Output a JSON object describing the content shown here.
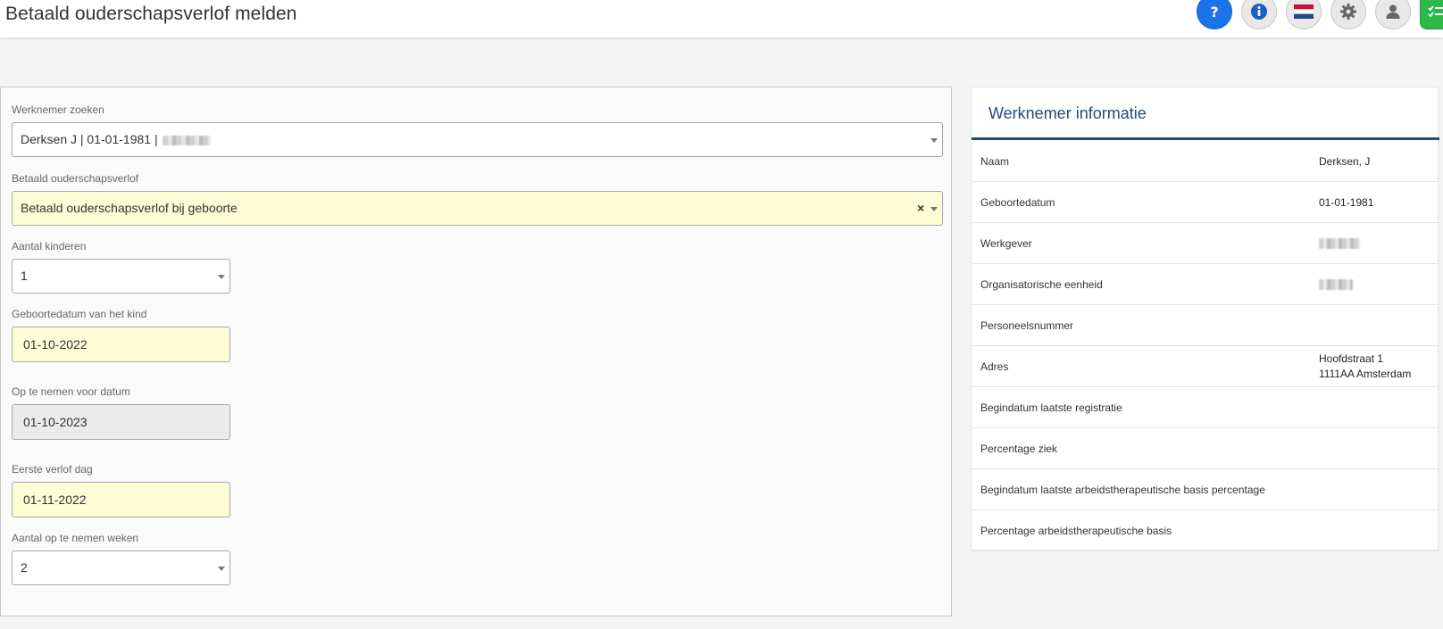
{
  "page": {
    "title": "Betaald ouderschapsverlof melden"
  },
  "header_icons": [
    {
      "name": "help-icon",
      "color": "#1a73e8"
    },
    {
      "name": "info-icon"
    },
    {
      "name": "dutch-flag-icon"
    },
    {
      "name": "gear-icon"
    },
    {
      "name": "user-icon"
    },
    {
      "name": "checklist-icon",
      "color": "#2db84a"
    }
  ],
  "form": {
    "werknemer_zoeken": {
      "label": "Werknemer zoeken",
      "value": "Derksen J | 01-01-1981 |"
    },
    "verlof_type": {
      "label": "Betaald ouderschapsverlof",
      "value": "Betaald ouderschapsverlof bij geboorte",
      "clear": "×"
    },
    "aantal_kinderen": {
      "label": "Aantal kinderen",
      "value": "1"
    },
    "geboortedatum_kind": {
      "label": "Geboortedatum van het kind",
      "value": "01-10-2022"
    },
    "op_te_nemen_voor": {
      "label": "Op te nemen voor datum",
      "value": "01-10-2023"
    },
    "eerste_verlof_dag": {
      "label": "Eerste verlof dag",
      "value": "01-11-2022"
    },
    "aantal_weken": {
      "label": "Aantal op te nemen weken",
      "value": "2"
    }
  },
  "info": {
    "title": "Werknemer informatie",
    "rows": [
      {
        "key": "Naam",
        "value": "Derksen, J"
      },
      {
        "key": "Geboortedatum",
        "value": "01-01-1981"
      },
      {
        "key": "Werkgever",
        "value": ""
      },
      {
        "key": "Organisatorische eenheid",
        "value": ""
      },
      {
        "key": "Personeelsnummer",
        "value": ""
      },
      {
        "key": "Adres",
        "value_line1": "Hoofdstraat 1",
        "value_line2": "1111AA Amsterdam"
      },
      {
        "key": "Begindatum laatste registratie",
        "value": ""
      },
      {
        "key": "Percentage ziek",
        "value": ""
      },
      {
        "key": "Begindatum laatste arbeidstherapeutische basis percentage",
        "value": ""
      },
      {
        "key": "Percentage arbeidstherapeutische basis",
        "value": ""
      }
    ]
  },
  "colors": {
    "accent": "#1f4a7c",
    "required_field_bg": "#fdfdd6",
    "disabled_field_bg": "#ebebeb"
  }
}
